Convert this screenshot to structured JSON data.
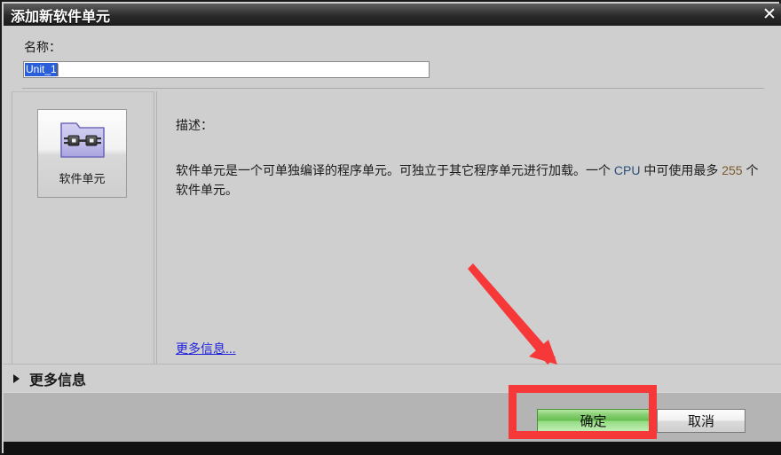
{
  "window": {
    "title": "添加新软件单元",
    "close_icon": "close-icon"
  },
  "form": {
    "name_label": "名称：",
    "name_value": "Unit_1"
  },
  "type_panel": {
    "tile_icon": "software-unit-folder-icon",
    "tile_label": "软件单元"
  },
  "description": {
    "heading": "描述：",
    "text_part1": "软件单元是一个可单独编译的程序单元。可独立于其它程序单元进行加载。一个 ",
    "cpu_term": "CPU",
    "text_part2": " 中可使用最多 ",
    "count_term": "255",
    "text_part3": " 个软件单元。",
    "more_link": "更多信息..."
  },
  "expander": {
    "arrow_icon": "triangle-right-icon",
    "label": "更多信息"
  },
  "footer": {
    "ok_label": "确定",
    "cancel_label": "取消"
  },
  "annotations": {
    "highlight_color": "#f73838",
    "arrow_icon": "red-arrow-icon",
    "rect_icon": "red-highlight-rect"
  }
}
